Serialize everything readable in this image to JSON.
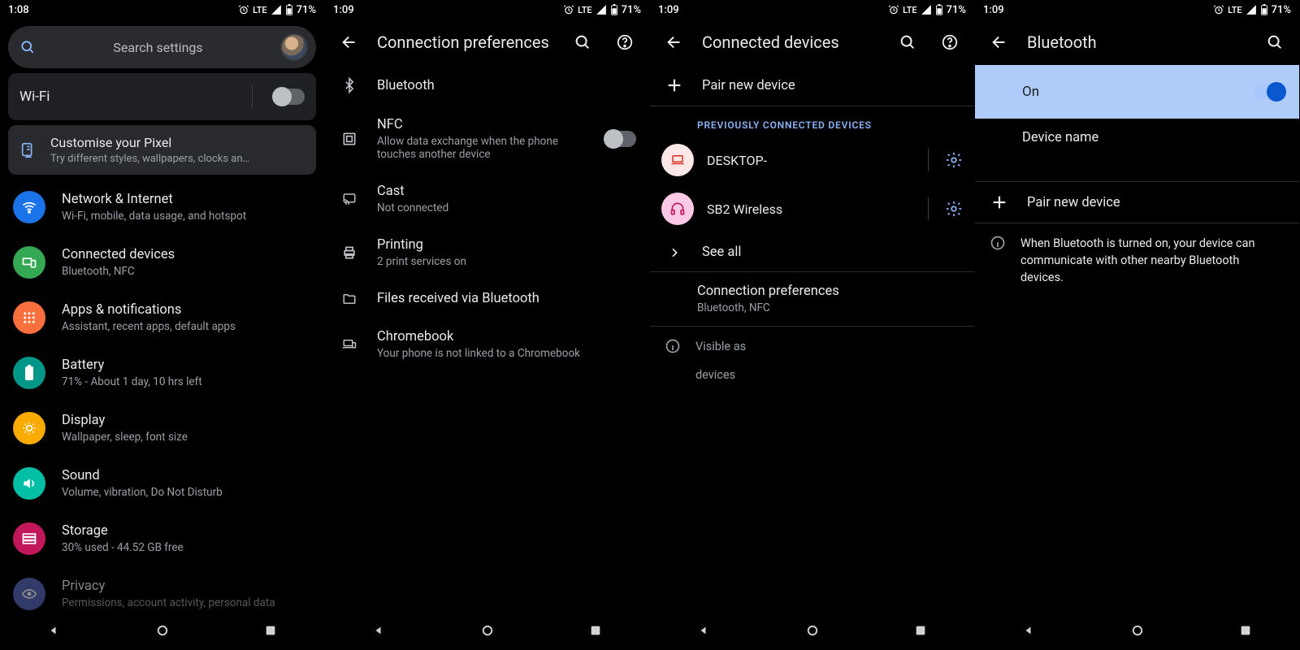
{
  "status": {
    "time1": "1:08",
    "time_rest": "1:09",
    "lte": "LTE",
    "battery": "71%"
  },
  "s1": {
    "search_placeholder": "Search settings",
    "wifi_label": "Wi-Fi",
    "customize": {
      "title": "Customise your Pixel",
      "sub": "Try different styles, wallpapers, clocks an…"
    },
    "items": [
      {
        "title": "Network & Internet",
        "sub": "Wi-Fi, mobile, data usage, and hotspot"
      },
      {
        "title": "Connected devices",
        "sub": "Bluetooth, NFC"
      },
      {
        "title": "Apps & notifications",
        "sub": "Assistant, recent apps, default apps"
      },
      {
        "title": "Battery",
        "sub": "71% - About 1 day, 10 hrs left"
      },
      {
        "title": "Display",
        "sub": "Wallpaper, sleep, font size"
      },
      {
        "title": "Sound",
        "sub": "Volume, vibration, Do Not Disturb"
      },
      {
        "title": "Storage",
        "sub": "30% used - 44.52 GB free"
      },
      {
        "title": "Privacy",
        "sub": "Permissions, account activity, personal data"
      }
    ]
  },
  "s2": {
    "title": "Connection preferences",
    "items": {
      "bluetooth": "Bluetooth",
      "nfc_title": "NFC",
      "nfc_sub": "Allow data exchange when the phone touches another device",
      "cast_title": "Cast",
      "cast_sub": "Not connected",
      "printing_title": "Printing",
      "printing_sub": "2 print services on",
      "files": "Files received via Bluetooth",
      "chromebook_title": "Chromebook",
      "chromebook_sub": "Your phone is not linked to a Chromebook"
    }
  },
  "s3": {
    "title": "Connected devices",
    "pair": "Pair new device",
    "section": "PREVIOUSLY CONNECTED DEVICES",
    "dev1": "DESKTOP-",
    "dev2": "SB2 Wireless",
    "see_all": "See all",
    "conn_pref": "Connection preferences",
    "conn_pref_sub": "Bluetooth, NFC",
    "visible1": "Visible as",
    "visible2": "devices"
  },
  "s4": {
    "title": "Bluetooth",
    "on": "On",
    "device_name": "Device name",
    "pair": "Pair new device",
    "info": "When Bluetooth is turned on, your device can communicate with other nearby Bluetooth devices."
  }
}
